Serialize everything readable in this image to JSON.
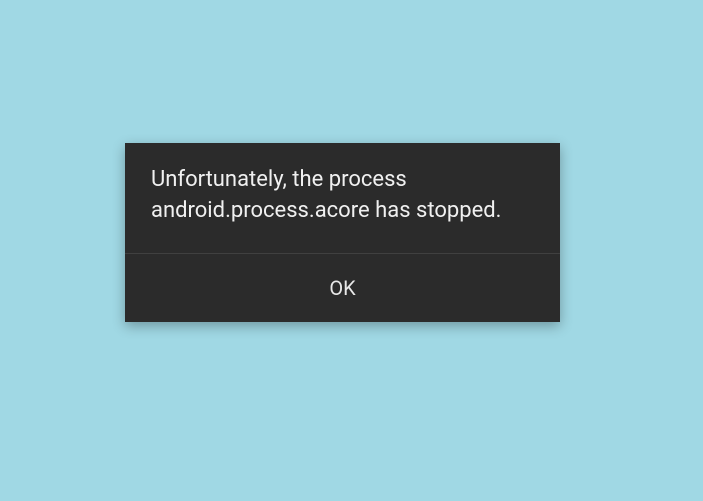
{
  "dialog": {
    "message": "Unfortunately, the process android.process.acore has stopped.",
    "ok_label": "OK"
  }
}
